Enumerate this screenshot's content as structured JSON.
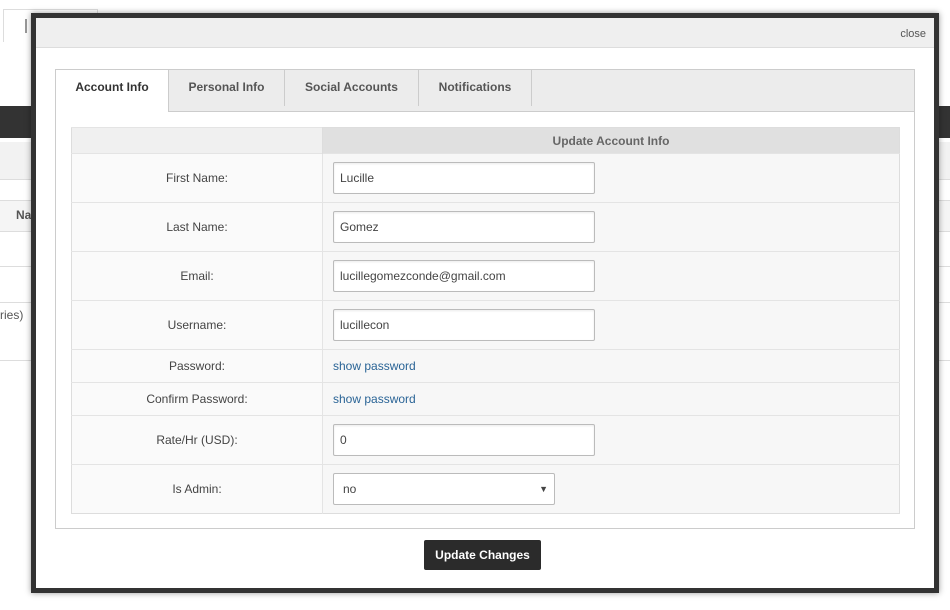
{
  "background": {
    "table_header_text": "Na",
    "footer_text": "ries)"
  },
  "modal": {
    "close_label": "close",
    "tabs": [
      {
        "label": "Account Info",
        "active": true
      },
      {
        "label": "Personal Info",
        "active": false
      },
      {
        "label": "Social Accounts",
        "active": false
      },
      {
        "label": "Notifications",
        "active": false
      }
    ],
    "section_title": "Update Account Info",
    "fields": {
      "first_name": {
        "label": "First Name:",
        "value": "Lucille"
      },
      "last_name": {
        "label": "Last Name:",
        "value": "Gomez"
      },
      "email": {
        "label": "Email:",
        "value": "lucillegomezconde@gmail.com"
      },
      "username": {
        "label": "Username:",
        "value": "lucillecon"
      },
      "password": {
        "label": "Password:",
        "link": "show password"
      },
      "confirm_password": {
        "label": "Confirm Password:",
        "link": "show password"
      },
      "rate": {
        "label": "Rate/Hr (USD):",
        "value": "0"
      },
      "is_admin": {
        "label": "Is Admin:",
        "value": "no",
        "arrow_icon": "caret-down-icon"
      }
    },
    "submit_label": "Update Changes"
  },
  "colors": {
    "modal_border": "#333333",
    "button_bg": "#2b2b2b",
    "link": "#2a6496"
  }
}
